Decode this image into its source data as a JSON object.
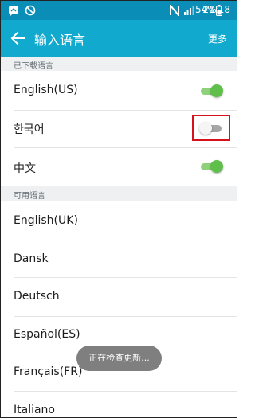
{
  "status_bar": {
    "battery_percent": "54%",
    "time": "21:18",
    "icons": [
      "message-icon",
      "blocked-icon",
      "nfc-icon",
      "signal-icon",
      "battery-icon"
    ]
  },
  "app_bar": {
    "title": "输入语言",
    "more_label": "更多"
  },
  "downloaded_section": {
    "header": "已下载语言",
    "items": [
      {
        "label": "English(US)",
        "enabled": true
      },
      {
        "label": "한국어",
        "enabled": false
      },
      {
        "label": "中文",
        "enabled": true
      }
    ]
  },
  "available_section": {
    "header": "可用语言",
    "items": [
      {
        "label": "English(UK)"
      },
      {
        "label": "Dansk"
      },
      {
        "label": "Deutsch"
      },
      {
        "label": "Español(ES)"
      },
      {
        "label": "Français(FR)"
      },
      {
        "label": "Italiano"
      }
    ]
  },
  "toast": "正在检查更新...",
  "colors": {
    "status_bar": "#0a8db6",
    "app_bar": "#12a9cf",
    "toggle_on": "#5fbf4a",
    "highlight_box": "#d5121b"
  }
}
